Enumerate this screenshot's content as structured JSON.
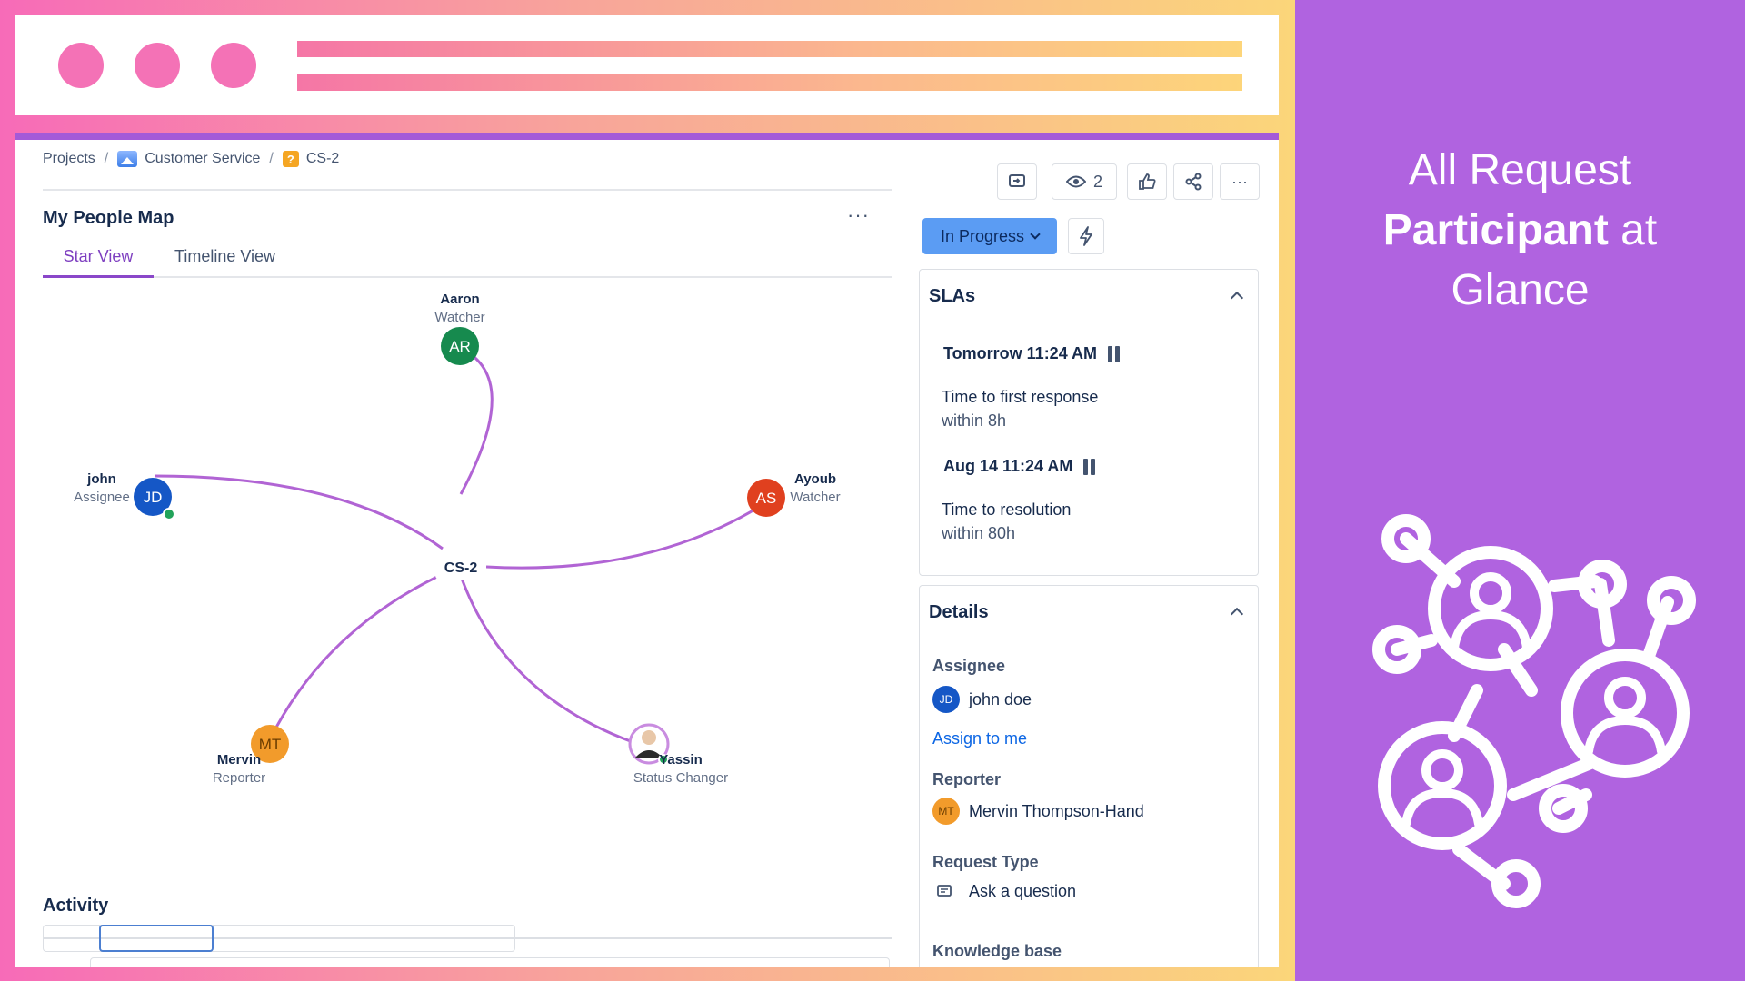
{
  "breadcrumb": {
    "projects": "Projects",
    "separator": "/",
    "project": "Customer Service",
    "issue": "CS-2",
    "issue_icon": "?"
  },
  "people_map": {
    "title": "My People Map",
    "more_label": "···",
    "tabs": [
      {
        "label": "Star View",
        "active": true
      },
      {
        "label": "Timeline View",
        "active": false
      }
    ],
    "center_label": "CS-2",
    "nodes": [
      {
        "name": "Aaron",
        "role": "Watcher",
        "initials": "AR",
        "color": "#168a4e"
      },
      {
        "name": "john",
        "role": "Assignee",
        "initials": "JD",
        "color": "#1557c6"
      },
      {
        "name": "Ayoub",
        "role": "Watcher",
        "initials": "AS",
        "color": "#e0401f"
      },
      {
        "name": "Mervin",
        "role": "Reporter",
        "initials": "MT",
        "color": "#f29b2b"
      },
      {
        "name": "Yassin",
        "role": "Status Changer",
        "initials": "",
        "color": "#c98ce0"
      }
    ],
    "edge_color": "#b164d4"
  },
  "activity": {
    "title": "Activity"
  },
  "actions": {
    "watchers_count": "2",
    "status_label": "In Progress",
    "more_label": "···"
  },
  "slas": {
    "title": "SLAs",
    "items": [
      {
        "time": "Tomorrow 11:24 AM",
        "label": "Time to first response",
        "sub": "within 8h"
      },
      {
        "time": "Aug 14 11:24 AM",
        "label": "Time to resolution",
        "sub": "within 80h"
      }
    ]
  },
  "details": {
    "title": "Details",
    "assignee_label": "Assignee",
    "assignee_name": "john doe",
    "assignee_initials": "JD",
    "assign_to_me": "Assign to me",
    "reporter_label": "Reporter",
    "reporter_name": "Mervin Thompson-Hand",
    "reporter_initials": "MT",
    "request_type_label": "Request Type",
    "request_type": "Ask a question",
    "knowledge_base_label": "Knowledge base"
  },
  "promo": {
    "line1": "All Request",
    "line2_bold": "Participant",
    "line2_rest": " at",
    "line3": "Glance"
  },
  "colors": {
    "accent_purple": "#b063e0",
    "status_blue": "#5b9cf3",
    "link_blue": "#0c66e4"
  }
}
